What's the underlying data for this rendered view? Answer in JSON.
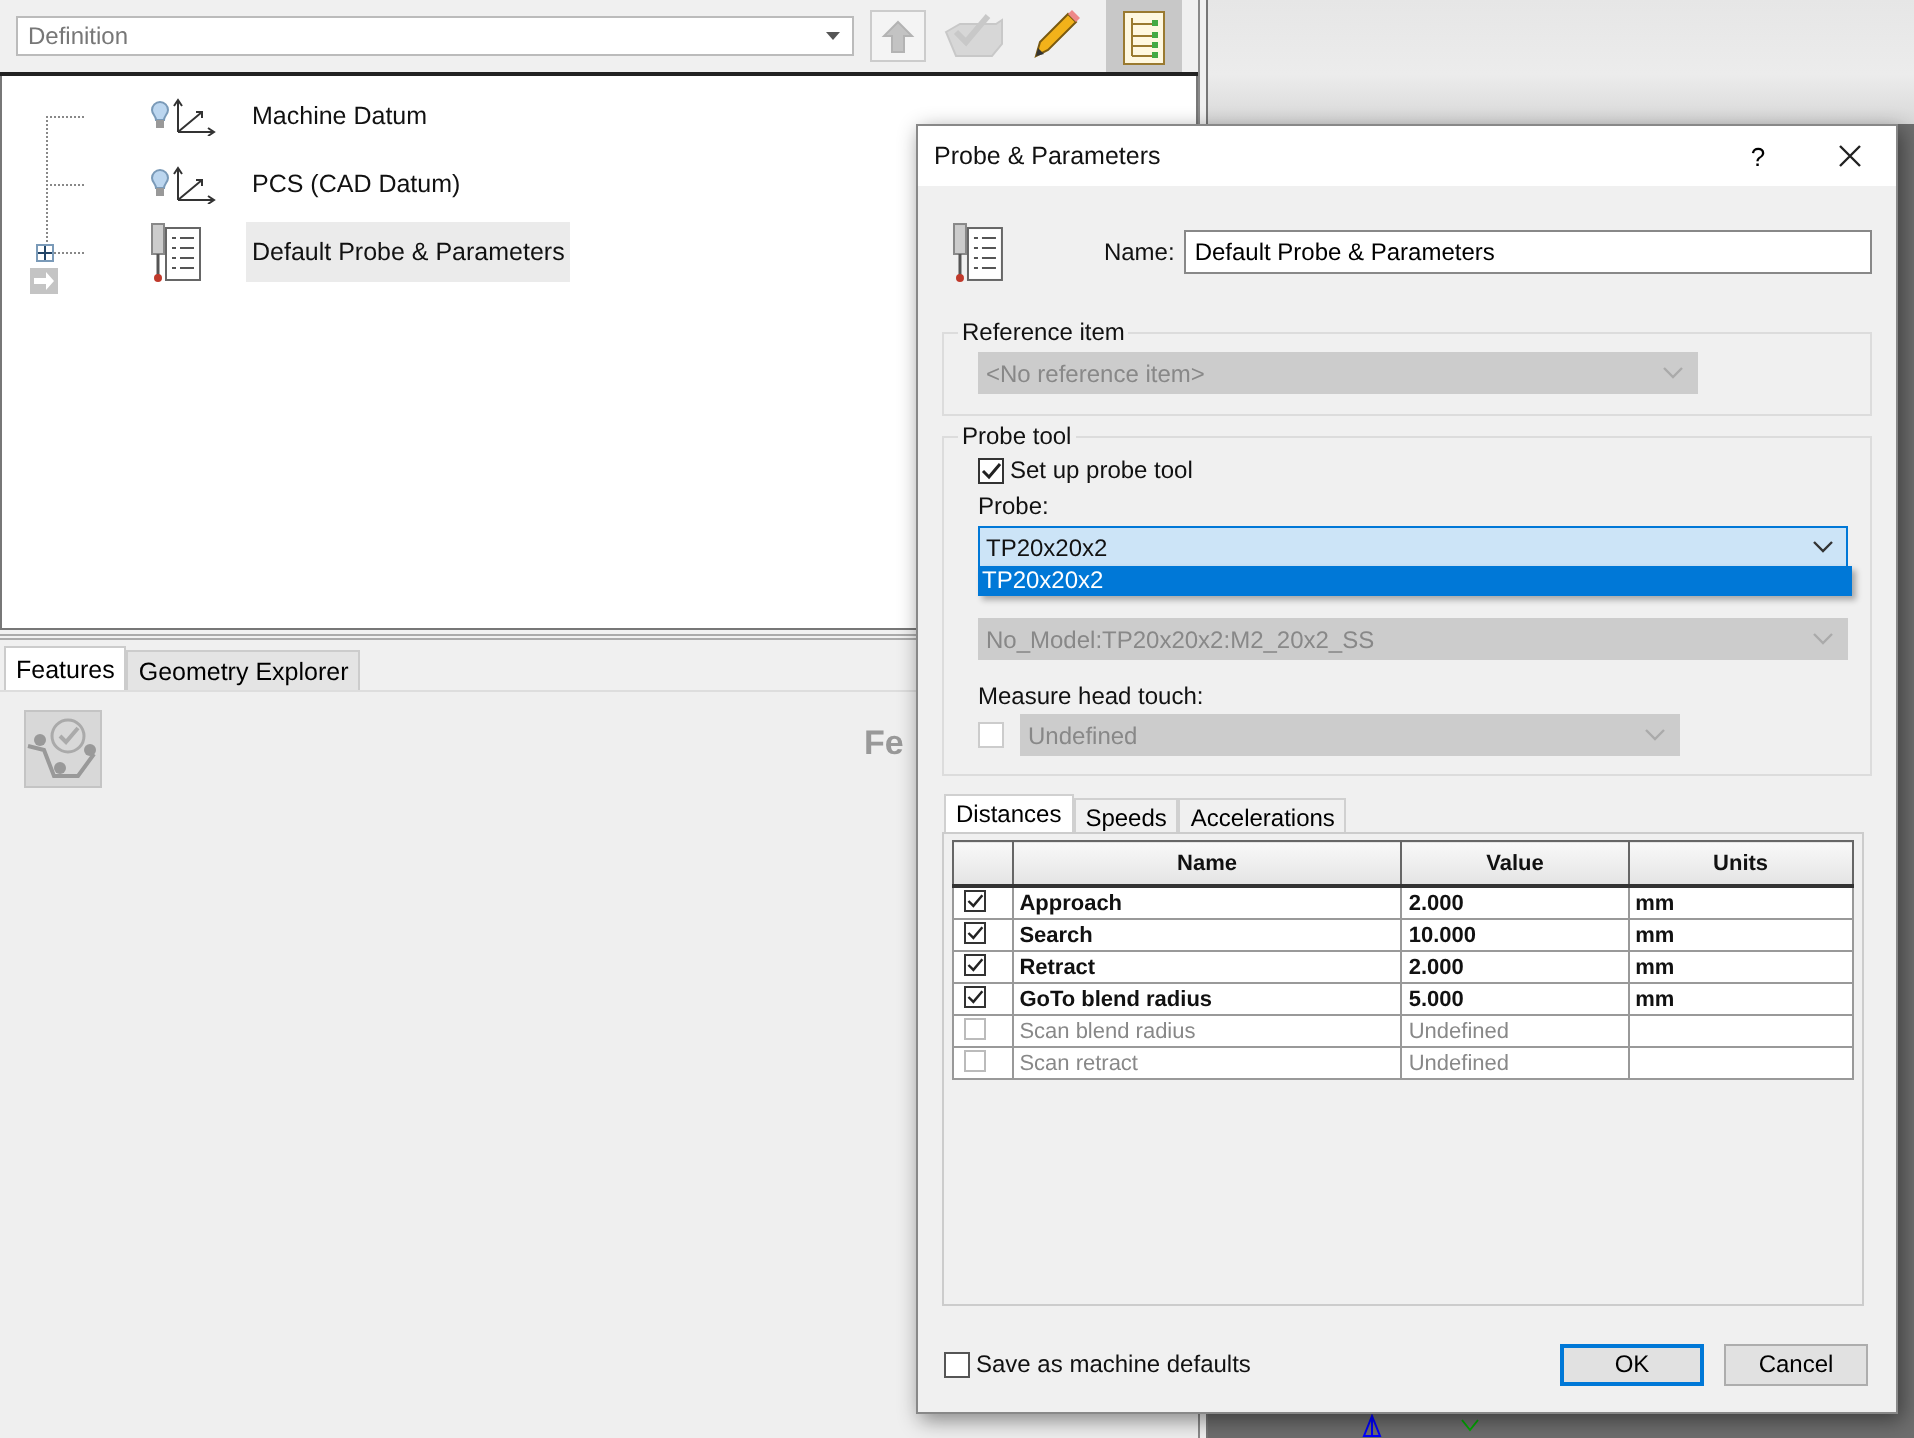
{
  "toolbar": {
    "combo": {
      "value": "Definition"
    },
    "tools": [
      {
        "kind": "up",
        "disabled": true,
        "selected": false
      },
      {
        "kind": "accept",
        "disabled": true,
        "selected": false
      },
      {
        "kind": "edit",
        "disabled": false,
        "selected": false
      },
      {
        "kind": "tree",
        "disabled": false,
        "selected": true
      }
    ]
  },
  "tree": {
    "items": [
      {
        "label": "Machine Datum",
        "kind": "datum",
        "selected": false
      },
      {
        "label": "PCS (CAD Datum)",
        "kind": "datum",
        "selected": false
      },
      {
        "label": "Default Probe & Parameters",
        "kind": "probe",
        "selected": true,
        "expanded": false
      }
    ]
  },
  "lower_panel": {
    "tabs": [
      {
        "label": "Features",
        "selected": true
      },
      {
        "label": "Geometry Explorer",
        "selected": false
      }
    ],
    "heading": "Fe"
  },
  "dialog": {
    "title": "Probe & Parameters",
    "help": "?",
    "name_label": "Name:",
    "name_value": "Default Probe & Parameters",
    "reference": {
      "legend": "Reference item",
      "value": "<No reference item>",
      "disabled": true
    },
    "probe_tool": {
      "legend": "Probe tool",
      "setup": {
        "label": "Set up probe tool",
        "checked": true
      },
      "probe_label": "Probe:",
      "probe_value": "TP20x20x2",
      "probe_options": [
        {
          "label": "TP20x20x2",
          "selected": true
        }
      ],
      "sensor_value": "No_Model:TP20x20x2:M2_20x2_SS",
      "sensor_disabled": true,
      "head_label": "Measure head touch:",
      "head_checked": false,
      "head_value": "Undefined",
      "head_disabled": true
    },
    "tabs": [
      {
        "label": "Distances",
        "selected": true
      },
      {
        "label": "Speeds",
        "selected": false
      },
      {
        "label": "Accelerations",
        "selected": false
      }
    ],
    "table": {
      "columns": [
        "Name",
        "Value",
        "Units"
      ],
      "rows": [
        {
          "checked": true,
          "enabled": true,
          "name": "Approach",
          "value": "2.000",
          "units": "mm"
        },
        {
          "checked": true,
          "enabled": true,
          "name": "Search",
          "value": "10.000",
          "units": "mm"
        },
        {
          "checked": true,
          "enabled": true,
          "name": "Retract",
          "value": "2.000",
          "units": "mm"
        },
        {
          "checked": true,
          "enabled": true,
          "name": "GoTo blend radius",
          "value": "5.000",
          "units": "mm"
        },
        {
          "checked": false,
          "enabled": false,
          "name": "Scan blend radius",
          "value": "Undefined"
        },
        {
          "checked": false,
          "enabled": false,
          "name": "Scan retract",
          "value": "Undefined"
        }
      ]
    },
    "save_defaults": {
      "label": "Save as machine defaults",
      "checked": false
    },
    "buttons": [
      {
        "label": "OK",
        "kind": "default"
      },
      {
        "label": "Cancel",
        "kind": "normal"
      }
    ]
  }
}
